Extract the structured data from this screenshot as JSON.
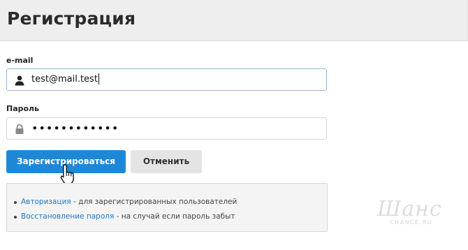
{
  "page": {
    "title": "Регистрация"
  },
  "form": {
    "email": {
      "label": "e-mail",
      "value": "test@mail.test",
      "icon": "user-icon"
    },
    "password": {
      "label": "Пароль",
      "value": "••••••••••••",
      "icon": "lock-icon"
    },
    "submit_label": "Зарегистрироваться",
    "cancel_label": "Отменить"
  },
  "info": {
    "items": [
      {
        "link": "Авторизация",
        "text": " - для зарегистрированных пользователей"
      },
      {
        "link": "Восстановление пароля",
        "text": " - на случай если пароль забыт"
      }
    ]
  },
  "watermark": {
    "script": "Шанс",
    "domain": "CHANCE.RU"
  },
  "colors": {
    "accent": "#1e88d6",
    "link": "#1e78c2",
    "header_bg": "#eeeeee"
  }
}
